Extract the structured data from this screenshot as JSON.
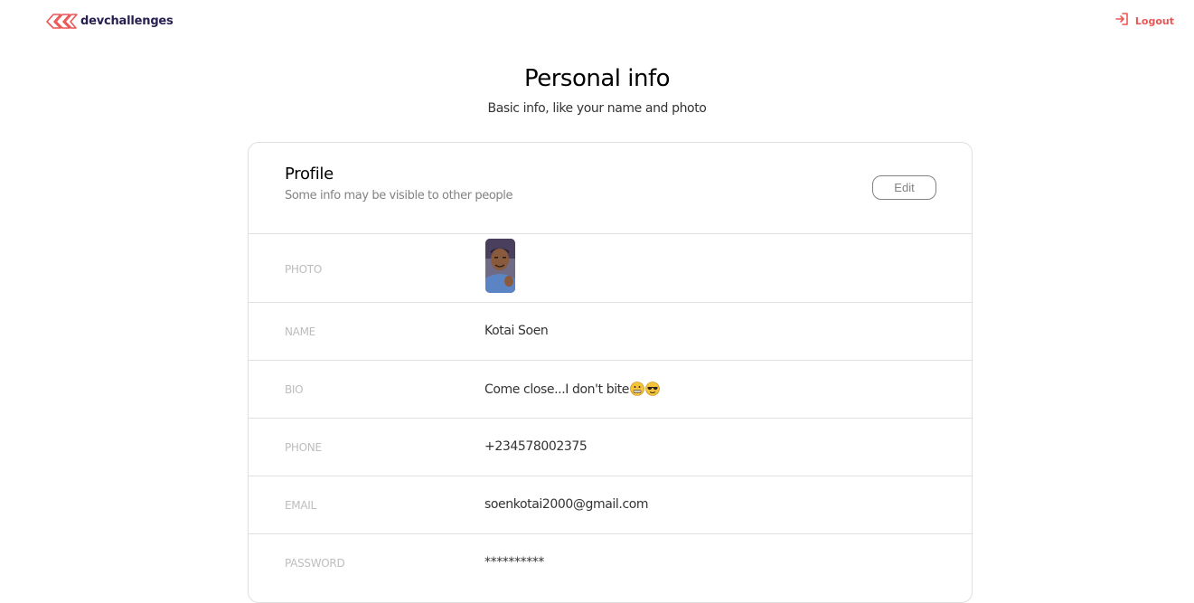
{
  "header": {
    "brand": "devchallenges",
    "brand_icon": "devchallenges-logo-icon",
    "logout_label": "Logout",
    "logout_icon": "logout-icon",
    "accent_color": "#eb5757"
  },
  "page": {
    "title": "Personal info",
    "subtitle": "Basic info, like your name and photo"
  },
  "profile": {
    "title": "Profile",
    "description": "Some info may be visible to other people",
    "edit_label": "Edit",
    "rows": {
      "photo": {
        "label": "PHOTO"
      },
      "name": {
        "label": "NAME",
        "value": "Kotai Soen"
      },
      "bio": {
        "label": "BIO",
        "value": "Come close...I don't bite",
        "emojis": [
          "grimacing-emoji-icon",
          "sunglasses-emoji-icon"
        ]
      },
      "phone": {
        "label": "PHONE",
        "value": "+234578002375"
      },
      "email": {
        "label": "EMAIL",
        "value": "soenkotai2000@gmail.com"
      },
      "password": {
        "label": "PASSWORD",
        "value": "**********"
      }
    }
  }
}
